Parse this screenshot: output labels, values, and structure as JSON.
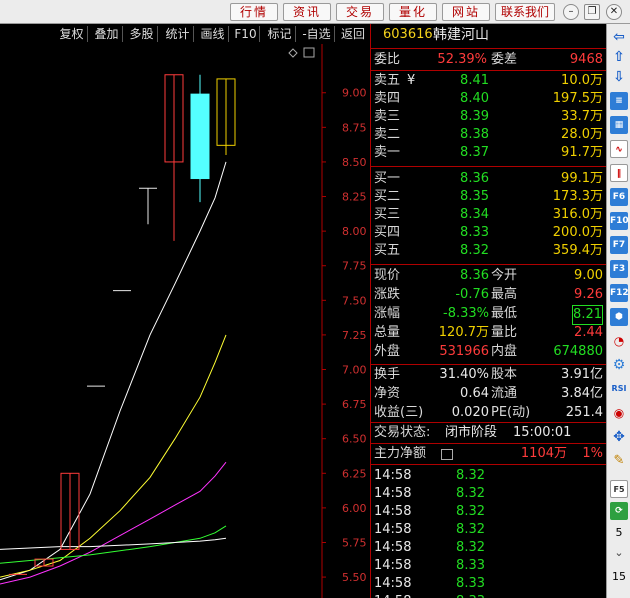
{
  "topnav": [
    "行情",
    "资讯",
    "交易",
    "量化",
    "网站",
    "联系我们"
  ],
  "chart_toolbar": [
    "复权",
    "叠加",
    "多股",
    "统计",
    "画线",
    "F10",
    "标记",
    "-自选",
    "返回"
  ],
  "chart_data": {
    "type": "candlestick",
    "y_ticks": [
      "9.00",
      "8.75",
      "8.50",
      "8.25",
      "8.00",
      "7.75",
      "7.50",
      "7.25",
      "7.00",
      "6.75",
      "6.50",
      "6.25",
      "6.00",
      "5.75",
      "5.50"
    ],
    "ylim": [
      5.45,
      9.28
    ],
    "candles": [
      {
        "open": 5.52,
        "close": 5.52,
        "high": 5.52,
        "low": 5.52,
        "color": "red"
      },
      {
        "open": 5.58,
        "close": 5.63,
        "high": 5.63,
        "low": 5.58,
        "color": "red"
      },
      {
        "open": 5.7,
        "close": 6.25,
        "high": 6.25,
        "low": 5.7,
        "color": "red"
      },
      {
        "open": 6.88,
        "close": 6.88,
        "high": 6.88,
        "low": 6.88,
        "color": "white"
      },
      {
        "open": 7.57,
        "close": 7.57,
        "high": 7.57,
        "low": 7.57,
        "color": "white"
      },
      {
        "open": 8.31,
        "close": 8.31,
        "high": 8.31,
        "low": 8.05,
        "color": "white"
      },
      {
        "open": 8.5,
        "close": 9.13,
        "high": 9.13,
        "low": 7.93,
        "color": "red"
      },
      {
        "open": 8.38,
        "close": 8.99,
        "high": 9.13,
        "low": 8.21,
        "color": "cyan"
      },
      {
        "open": 8.62,
        "close": 9.1,
        "high": 9.1,
        "low": 8.55,
        "color": "yellow"
      }
    ],
    "ma_lines": [
      {
        "color": "#ffffff",
        "values": [
          5.48,
          5.55,
          5.7,
          6.1,
          6.7,
          7.25,
          7.62,
          8.0,
          8.24,
          8.5
        ]
      },
      {
        "color": "#ffff33",
        "values": [
          5.5,
          5.55,
          5.62,
          5.78,
          5.98,
          6.22,
          6.5,
          6.8,
          7.05,
          7.25
        ]
      },
      {
        "color": "#ff33ff",
        "values": [
          5.45,
          5.5,
          5.58,
          5.68,
          5.8,
          5.92,
          6.02,
          6.12,
          6.23,
          6.33
        ]
      },
      {
        "color": "#33ff33",
        "values": [
          5.6,
          5.62,
          5.64,
          5.66,
          5.69,
          5.72,
          5.75,
          5.78,
          5.82,
          5.87
        ]
      },
      {
        "color": "#ffffff",
        "values": [
          5.7,
          5.71,
          5.72,
          5.72,
          5.73,
          5.74,
          5.75,
          5.76,
          5.77,
          5.78
        ]
      }
    ]
  },
  "stock": {
    "code": "603616",
    "name": "韩建河山",
    "weibi_label": "委比",
    "weibi_value": "52.39%",
    "weicha_label": "委差",
    "weicha_value": "9468"
  },
  "sell_orders": [
    {
      "label": "卖五",
      "mark": "¥",
      "price": "8.41",
      "vol": "10.0万"
    },
    {
      "label": "卖四",
      "mark": "",
      "price": "8.40",
      "vol": "197.5万"
    },
    {
      "label": "卖三",
      "mark": "",
      "price": "8.39",
      "vol": "33.7万"
    },
    {
      "label": "卖二",
      "mark": "",
      "price": "8.38",
      "vol": "28.0万"
    },
    {
      "label": "卖一",
      "mark": "",
      "price": "8.37",
      "vol": "91.7万"
    }
  ],
  "buy_orders": [
    {
      "label": "买一",
      "price": "8.36",
      "vol": "99.1万"
    },
    {
      "label": "买二",
      "price": "8.35",
      "vol": "173.3万"
    },
    {
      "label": "买三",
      "price": "8.34",
      "vol": "316.0万"
    },
    {
      "label": "买四",
      "price": "8.33",
      "vol": "200.0万"
    },
    {
      "label": "买五",
      "price": "8.32",
      "vol": "359.4万"
    }
  ],
  "stats": [
    {
      "l1": "现价",
      "v1": "8.36",
      "c1": "green",
      "l2": "今开",
      "v2": "9.00",
      "c2": "yellow"
    },
    {
      "l1": "涨跌",
      "v1": "-0.76",
      "c1": "green",
      "l2": "最高",
      "v2": "9.26",
      "c2": "red"
    },
    {
      "l1": "涨幅",
      "v1": "-8.33%",
      "c1": "green",
      "l2": "最低",
      "v2": "8.21",
      "c2": "green"
    },
    {
      "l1": "总量",
      "v1": "120.7万",
      "c1": "yellow",
      "l2": "量比",
      "v2": "2.44",
      "c2": "red"
    },
    {
      "l1": "外盘",
      "v1": "531966",
      "c1": "red",
      "l2": "内盘",
      "v2": "674880",
      "c2": "green"
    }
  ],
  "fundamentals": [
    {
      "l1": "换手",
      "v1": "31.40%",
      "l2": "股本",
      "v2": "3.91亿"
    },
    {
      "l1": "净资",
      "v1": "0.64",
      "l2": "流通",
      "v2": "3.84亿"
    },
    {
      "l1": "收益(三)",
      "v1": "0.020",
      "l2": "PE(动)",
      "v2": "251.4"
    }
  ],
  "trade_status": {
    "label": "交易状态:",
    "value": "闭市阶段",
    "time": "15:00:01"
  },
  "main_force": {
    "label": "主力净额",
    "value": "1104万",
    "pct": "1%"
  },
  "ticks": [
    {
      "time": "14:58",
      "price": "8.32"
    },
    {
      "time": "14:58",
      "price": "8.32"
    },
    {
      "time": "14:58",
      "price": "8.32"
    },
    {
      "time": "14:58",
      "price": "8.32"
    },
    {
      "time": "14:58",
      "price": "8.32"
    },
    {
      "time": "14:58",
      "price": "8.33"
    },
    {
      "time": "14:58",
      "price": "8.33"
    },
    {
      "time": "14:58",
      "price": "8.33"
    }
  ],
  "sidebar": {
    "numbers": [
      "5",
      "15"
    ]
  }
}
